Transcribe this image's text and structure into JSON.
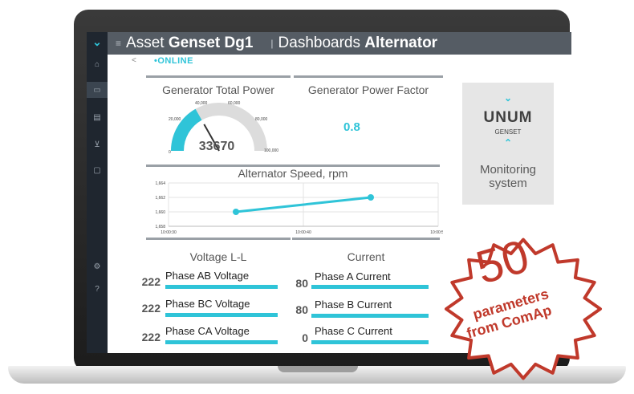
{
  "header": {
    "asset_prefix": "Asset",
    "asset_name": "Genset Dg1",
    "dashboards_prefix": "Dashboards",
    "dashboard_name": "Alternator",
    "menu_glyph": "≡",
    "separator": "|"
  },
  "status": {
    "back_glyph": "<",
    "online": "•ONLINE"
  },
  "sidebar": {
    "icons": [
      "chevron-down-icon",
      "home-icon",
      "monitor-icon",
      "document-icon",
      "chart-icon",
      "chat-icon",
      "settings-icon",
      "help-icon"
    ],
    "chevron": "⌄",
    "glyphs": [
      "⌂",
      "▭",
      "▤",
      "⊻",
      "▢",
      "⚙",
      "?"
    ]
  },
  "widgets": {
    "total_power": {
      "title": "Generator Total Power",
      "value": "33670",
      "min": 0,
      "max": 100000,
      "scale_labels": [
        "0",
        "20,000",
        "40,000",
        "60,000",
        "80,000",
        "100,000"
      ],
      "fraction": 0.3367
    },
    "power_factor": {
      "title": "Generator Power Factor",
      "value": "0.8"
    },
    "speed_chart": {
      "title": "Alternator Speed, rpm"
    },
    "voltage": {
      "title": "Voltage L-L",
      "rows": [
        {
          "value": "222",
          "label": "Phase AB Voltage"
        },
        {
          "value": "222",
          "label": "Phase BC Voltage"
        },
        {
          "value": "222",
          "label": "Phase CA Voltage"
        }
      ]
    },
    "current": {
      "title": "Current",
      "rows": [
        {
          "value": "80",
          "label": "Phase A Current"
        },
        {
          "value": "80",
          "label": "Phase B Current"
        },
        {
          "value": "0",
          "label": "Phase C Current"
        }
      ]
    }
  },
  "logo": {
    "word": "UNUM",
    "sub": "GENSET",
    "tagline": "Monitoring system",
    "tagline_line1": "Monitoring",
    "tagline_line2": "system"
  },
  "badge": {
    "number": "50",
    "line1": "parameters",
    "line2": "from ComAp"
  },
  "colors": {
    "accent": "#2fc4d8",
    "badge": "#c0392b",
    "header": "#555c64",
    "sidebar": "#1f262f"
  },
  "chart_data": {
    "type": "line",
    "title": "Alternator Speed, rpm",
    "x": [
      "10:00:35",
      "10:00:45"
    ],
    "x_ticks": [
      "10:00:30",
      "10:00:40",
      "10:00:50"
    ],
    "y_ticks": [
      "1,658",
      "1,660",
      "1,662",
      "1,664"
    ],
    "series": [
      {
        "values": [
          1660,
          1662
        ]
      }
    ],
    "xlim": [
      "10:00:30",
      "10:00:50"
    ],
    "ylim": [
      1658,
      1664
    ],
    "grid": true
  }
}
